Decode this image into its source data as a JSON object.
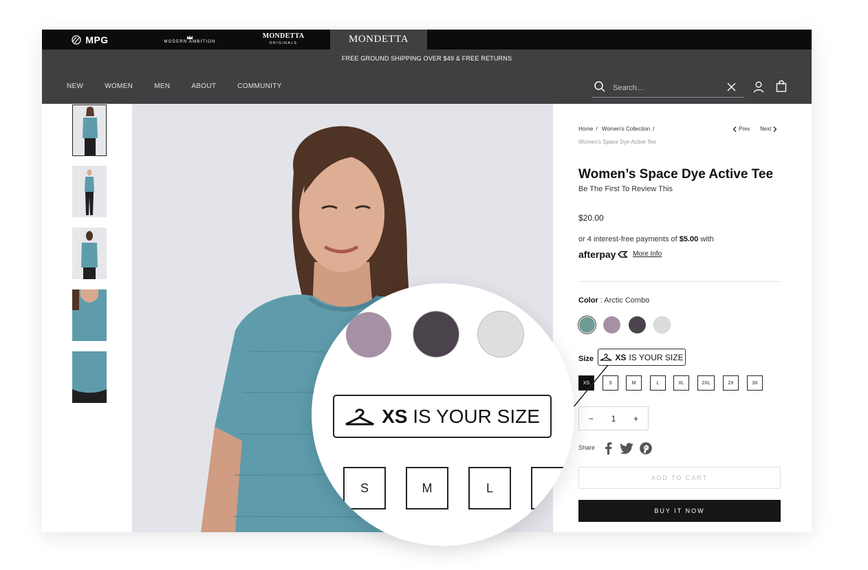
{
  "brands": {
    "mpg": "MPG",
    "modern_ambition": "MODERN AMBITION",
    "mondetta_originals_top": "MONDETTA",
    "mondetta_originals_sub": "ORIGINALS",
    "mondetta": "MONDETTA"
  },
  "promo": "FREE GROUND SHIPPING OVER $49 & FREE RETURNS",
  "nav": [
    "NEW",
    "WOMEN",
    "MEN",
    "ABOUT",
    "COMMUNITY"
  ],
  "search": {
    "placeholder": "Search..."
  },
  "breadcrumb": {
    "home": "Home",
    "collection": "Women's Collection",
    "current": "Women's Space Dye Active Tee",
    "prev": "Prev",
    "next": "Next"
  },
  "product": {
    "title": "Women’s Space Dye Active Tee",
    "review": "Be The First To Review This",
    "price": "$20.00",
    "afterpay_prefix": "or 4 interest-free payments of ",
    "afterpay_amount": "$5.00",
    "afterpay_suffix": " with",
    "afterpay_logo": "afterpay",
    "more_info": "More Info",
    "color_label": "Color",
    "color_value": " : Arctic Combo",
    "size_label": "Size",
    "size_badge_strong": "XS",
    "size_badge_rest": " IS YOUR SIZE",
    "sizes": [
      "XS",
      "S",
      "M",
      "L",
      "XL",
      "2XL",
      "2X",
      "3X"
    ],
    "selected_size": "XS",
    "qty": "1",
    "qty_minus": "−",
    "qty_plus": "+",
    "share": "Share",
    "add_to_cart": "ADD TO CART",
    "buy_now": "BUY IT NOW"
  },
  "colors": {
    "swatches": [
      "#6e9a94",
      "#a690a5",
      "#4a434c",
      "#dcdcdc"
    ],
    "accent_dark": "#404043",
    "brand_bar": "#0c0c0c",
    "shirt": "#5e9cac"
  },
  "magnifier": {
    "badge_strong": "XS",
    "badge_rest": " IS YOUR SIZE",
    "sizes": [
      "S",
      "M",
      "L"
    ]
  }
}
